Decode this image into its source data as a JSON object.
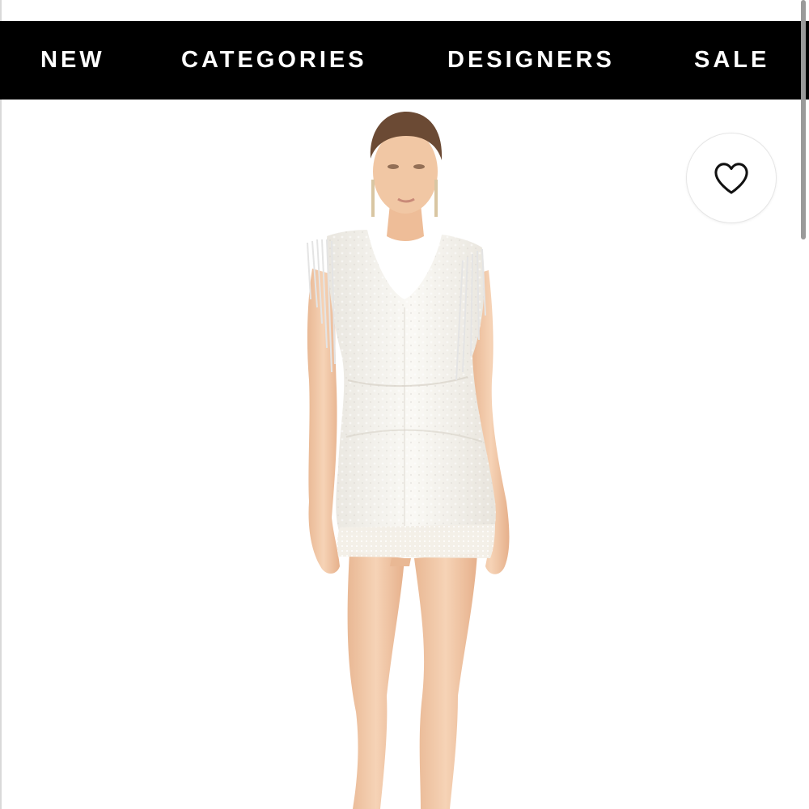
{
  "nav": {
    "items": [
      {
        "label": "NEW"
      },
      {
        "label": "CATEGORIES"
      },
      {
        "label": "DESIGNERS"
      },
      {
        "label": "SALE"
      }
    ]
  },
  "product": {
    "image_icon": "product-photo-white-sequin-mini-dress",
    "wishlist_icon": "heart-outline-icon"
  },
  "colors": {
    "nav_background": "#000000",
    "nav_text": "#ffffff",
    "page_background": "#ffffff",
    "dress": "#f4f1ea",
    "skin": "#f1c9a7",
    "hair": "#6b4a34"
  }
}
